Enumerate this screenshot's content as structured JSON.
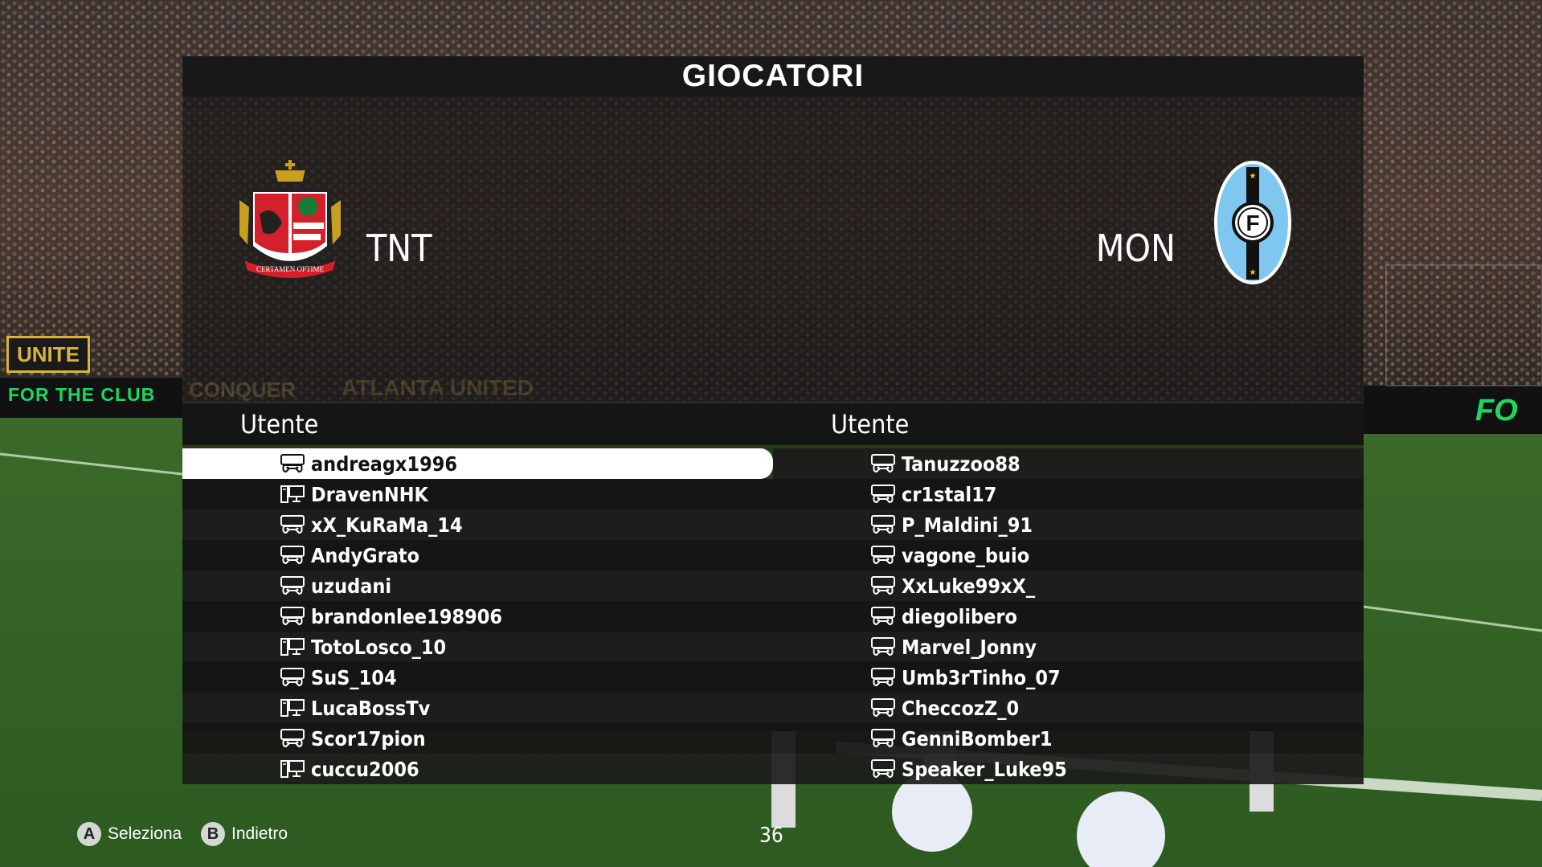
{
  "title": "GIOCATORI",
  "teams": {
    "home": {
      "abbr": "TNT",
      "crest_motto": "CERTAMEN OPTIME"
    },
    "away": {
      "abbr": "MON",
      "crest_letter": "F"
    }
  },
  "columns": {
    "left_header": "Utente",
    "right_header": "Utente"
  },
  "home_players": [
    {
      "name": "andreagx1996",
      "platform": "console",
      "selected": true
    },
    {
      "name": "DravenNHK",
      "platform": "pc"
    },
    {
      "name": "xX_KuRaMa_14",
      "platform": "console"
    },
    {
      "name": "AndyGrato",
      "platform": "console"
    },
    {
      "name": "uzudani",
      "platform": "console"
    },
    {
      "name": "brandonlee198906",
      "platform": "console"
    },
    {
      "name": "TotoLosco_10",
      "platform": "pc"
    },
    {
      "name": "SuS_104",
      "platform": "console"
    },
    {
      "name": "LucaBossTv",
      "platform": "pc"
    },
    {
      "name": "Scor17pion",
      "platform": "console"
    },
    {
      "name": "cuccu2006",
      "platform": "pc"
    }
  ],
  "away_players": [
    {
      "name": "Tanuzzoo88",
      "platform": "console"
    },
    {
      "name": "cr1stal17",
      "platform": "console"
    },
    {
      "name": "P_Maldini_91",
      "platform": "console"
    },
    {
      "name": "vagone_buio",
      "platform": "console"
    },
    {
      "name": "XxLuke99xX_",
      "platform": "console"
    },
    {
      "name": "diegolibero",
      "platform": "console"
    },
    {
      "name": "Marvel_Jonny",
      "platform": "console"
    },
    {
      "name": "Umb3rTinho_07",
      "platform": "console"
    },
    {
      "name": "CheccozZ_0",
      "platform": "console"
    },
    {
      "name": "GenniBomber1",
      "platform": "console"
    },
    {
      "name": "Speaker_Luke95",
      "platform": "console"
    }
  ],
  "footer": {
    "select_key": "A",
    "select_label": "Seleziona",
    "back_key": "B",
    "back_label": "Indietro",
    "page_number": "36"
  },
  "background": {
    "stadium_banner_1": "UNITE",
    "stadium_banner_2": "FOR THE CLUB",
    "stadium_banner_3": "FO",
    "stadium_banner_4": "CONQUER",
    "stadium_banner_5": "ATLANTA UNITED"
  },
  "colors": {
    "selected_row_bg": "#ffffff",
    "accent_green": "#1ed760",
    "crest_left_red": "#d3202a",
    "crest_right_blue": "#7ec8ef"
  }
}
